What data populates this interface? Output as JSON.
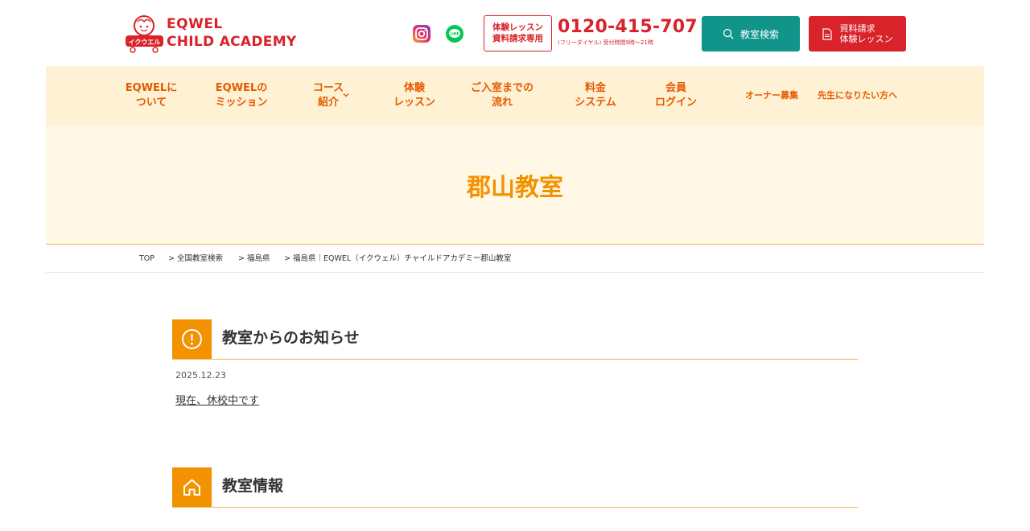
{
  "header": {
    "logo": {
      "line1": "EQWEL",
      "line2": "CHILD ACADEMY",
      "badge": "イクウエル"
    },
    "social": [
      "instagram-icon",
      "line-icon"
    ],
    "trial_box": {
      "line1": "体験レッスン",
      "line2": "資料請求専用"
    },
    "phone": {
      "number": "0120-415-707",
      "note": "(フリーダイヤル) 受付時間9時〜21時"
    },
    "search_button": "教室検索",
    "request_button": {
      "line1": "資料請求",
      "line2": "体験レッスン"
    }
  },
  "nav": {
    "items": [
      {
        "line1": "EQWELに",
        "line2": "ついて"
      },
      {
        "line1": "EQWELの",
        "line2": "ミッション"
      },
      {
        "line1": "コース",
        "line2": "紹介"
      },
      {
        "line1": "体験",
        "line2": "レッスン"
      },
      {
        "line1": "ご入室までの",
        "line2": "流れ"
      },
      {
        "line1": "料金",
        "line2": "システム"
      },
      {
        "line1": "会員",
        "line2": "ログイン"
      }
    ],
    "owner": "オーナー募集",
    "teacher": "先生になりたい方へ"
  },
  "hero": {
    "title": "郡山教室"
  },
  "breadcrumb": [
    "TOP",
    "> 全国教室検索",
    "> 福島県",
    "> 福島県｜EQWEL（イクウェル）チャイルドアカデミー郡山教室"
  ],
  "news": {
    "heading": "教室からのお知らせ",
    "date": "2025.12.23",
    "link": "現在、休校中です"
  },
  "info": {
    "heading": "教室情報"
  },
  "colors": {
    "brand_red": "#d8232a",
    "accent_orange": "#f39200",
    "nav_text": "#e65a00",
    "nav_bg": "#fff2d4",
    "hero_bg": "#fff8e6",
    "teal": "#11948a"
  }
}
